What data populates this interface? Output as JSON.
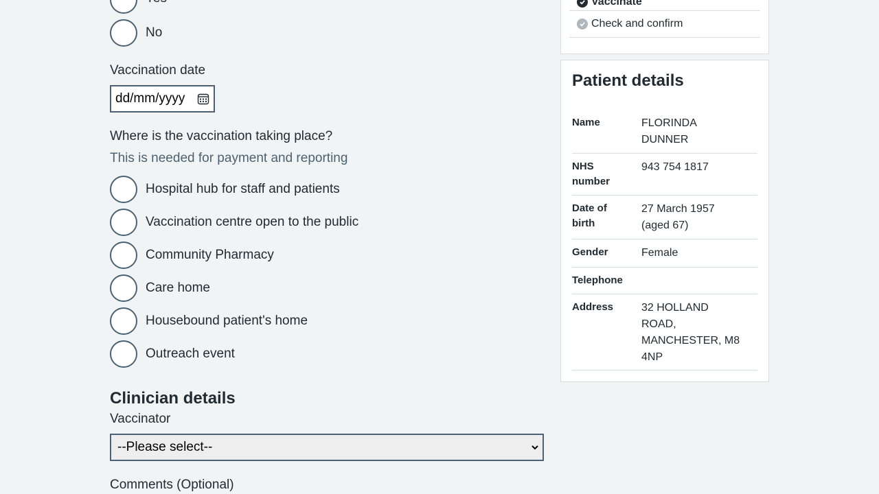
{
  "previous_question": {
    "options": [
      "Yes",
      "No"
    ]
  },
  "vaccination_date": {
    "label": "Vaccination date",
    "value": "dd/mm/yyyy",
    "icon": "calendar-icon"
  },
  "location": {
    "question": "Where is the vaccination taking place?",
    "hint": "This is needed for payment and reporting",
    "options": [
      "Hospital hub for staff and patients",
      "Vaccination centre open to the public",
      "Community Pharmacy",
      "Care home",
      "Housebound patient's home",
      "Outreach event"
    ]
  },
  "clinician": {
    "heading": "Clinician details",
    "vaccinator_label": "Vaccinator",
    "vaccinator_selected": "--Please select--",
    "comments_label": "Comments (Optional)"
  },
  "steps": {
    "items": [
      {
        "label": "Vaccinate",
        "status": "complete"
      },
      {
        "label": "Check and confirm",
        "status": "pending"
      }
    ]
  },
  "patient": {
    "heading": "Patient details",
    "rows": [
      {
        "key": "Name",
        "value": "FLORINDA DUNNER"
      },
      {
        "key": "NHS number",
        "value": "943 754 1817"
      },
      {
        "key": "Date of birth",
        "value": "27 March 1957 (aged 67)"
      },
      {
        "key": "Gender",
        "value": "Female"
      },
      {
        "key": "Telephone",
        "value": ""
      },
      {
        "key": "Address",
        "value": "32 HOLLAND ROAD, MANCHESTER, M8 4NP"
      }
    ]
  },
  "colors": {
    "background": "#f0f4f5",
    "text": "#212b32",
    "secondary_text": "#4c6272",
    "border": "#d8dde0",
    "complete_icon": "#212b32",
    "pending_icon": "#aeb7bd"
  }
}
